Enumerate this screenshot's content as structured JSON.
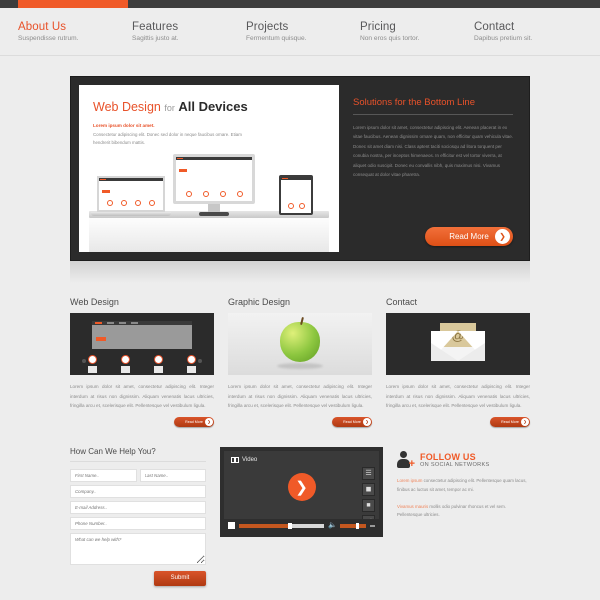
{
  "nav": {
    "items": [
      {
        "title": "About Us",
        "sub": "Suspendisse rutrum.",
        "active": true
      },
      {
        "title": "Features",
        "sub": "Sagittis justo at.",
        "active": false
      },
      {
        "title": "Projects",
        "sub": "Fermentum quisque.",
        "active": false
      },
      {
        "title": "Pricing",
        "sub": "Non eros quis tortor.",
        "active": false
      },
      {
        "title": "Contact",
        "sub": "Dapibus pretium sit.",
        "active": false
      }
    ]
  },
  "hero": {
    "headline_a": "Web Design",
    "headline_for": "for",
    "headline_b": "All Devices",
    "lead": "Lorem ipsum dolor sit amet.",
    "sub": "Consectetur adipiscing elit. Donec sed dolor in neque faucibus ornare. Etiam hendrerit bibendum mattis.",
    "panel_title_accent": "Solutions",
    "panel_title_rest": " for the Bottom Line",
    "panel_body": "Lorem ipsum dolor sit amet, consectetur adipiscing elit. Aenean placerat in ex vitae faucibus. Aenean dignissim ornare quam, non efficitur quam vehicula vitae. Donec sit amet diam nisi. Class aptent taciti sociosqu ad litora torquent per conubia nostra, per inceptos himenaeos. In efficitur est vel tortor viverra, at aliquet odio suscipit. Donec eu convallis nibh, quis maximus nisi. Vivamus consequat at dolor vitae pharetra.",
    "read_more": "Read More",
    "arrow": "❯"
  },
  "columns": [
    {
      "title": "Web Design",
      "body": "Lorem ipsum dolor sit amet, consectetur adipiscing elit. Integer interdum at risus non dignissim. Aliquam venenatis lacus ultricies, fringilla arcu et, scelerisque elit. Pellentesque vel vestibulum ligula.",
      "button": "Read More",
      "art": "web-design-thumb"
    },
    {
      "title": "Graphic Design",
      "body": "Lorem ipsum dolor sit amet, consectetur adipiscing elit. Integer interdum at risus non dignissim. Aliquam venenatis lacus ultricies, fringilla arcu et, scelerisque elit. Pellentesque vel vestibulum ligula.",
      "button": "Read More",
      "art": "green-apple"
    },
    {
      "title": "Contact",
      "body": "Lorem ipsum dolor sit amet, consectetur adipiscing elit. Integer interdum at risus non dignissim. Aliquam venenatis lacus ultricies, fringilla arcu et, scelerisque elit. Pellentesque vel vestibulum ligula.",
      "button": "Read More",
      "art": "envelope-at"
    }
  ],
  "form": {
    "title": "How Can We Help You?",
    "first_name": "First Name..",
    "last_name": "Last Name..",
    "company": "Company..",
    "email": "E-mail Address..",
    "phone": "Phone Number..",
    "message": "What can we help with?",
    "submit": "Submit"
  },
  "video": {
    "label": "Video",
    "hd_badge": "HD",
    "play": "▶",
    "icons": [
      "list-icon",
      "screen-icon",
      "chart-icon",
      "signal-icon"
    ],
    "speaker": "🔊"
  },
  "follow": {
    "title": "FOLLOW US",
    "subtitle": "ON SOCIAL NETWORKS",
    "p1_link": "Lorem ipsum",
    "p1": " consectetur adipiscing elit. Pellentesque quam lacus, finibus ac luctus sit amet, tempor ac mi.",
    "p2_link": "Vivamus mauris",
    "p2": " mollis odio pulvinar rhoncus et vel sem. Pellentesque ultricies.",
    "accent": "#f05a28"
  }
}
